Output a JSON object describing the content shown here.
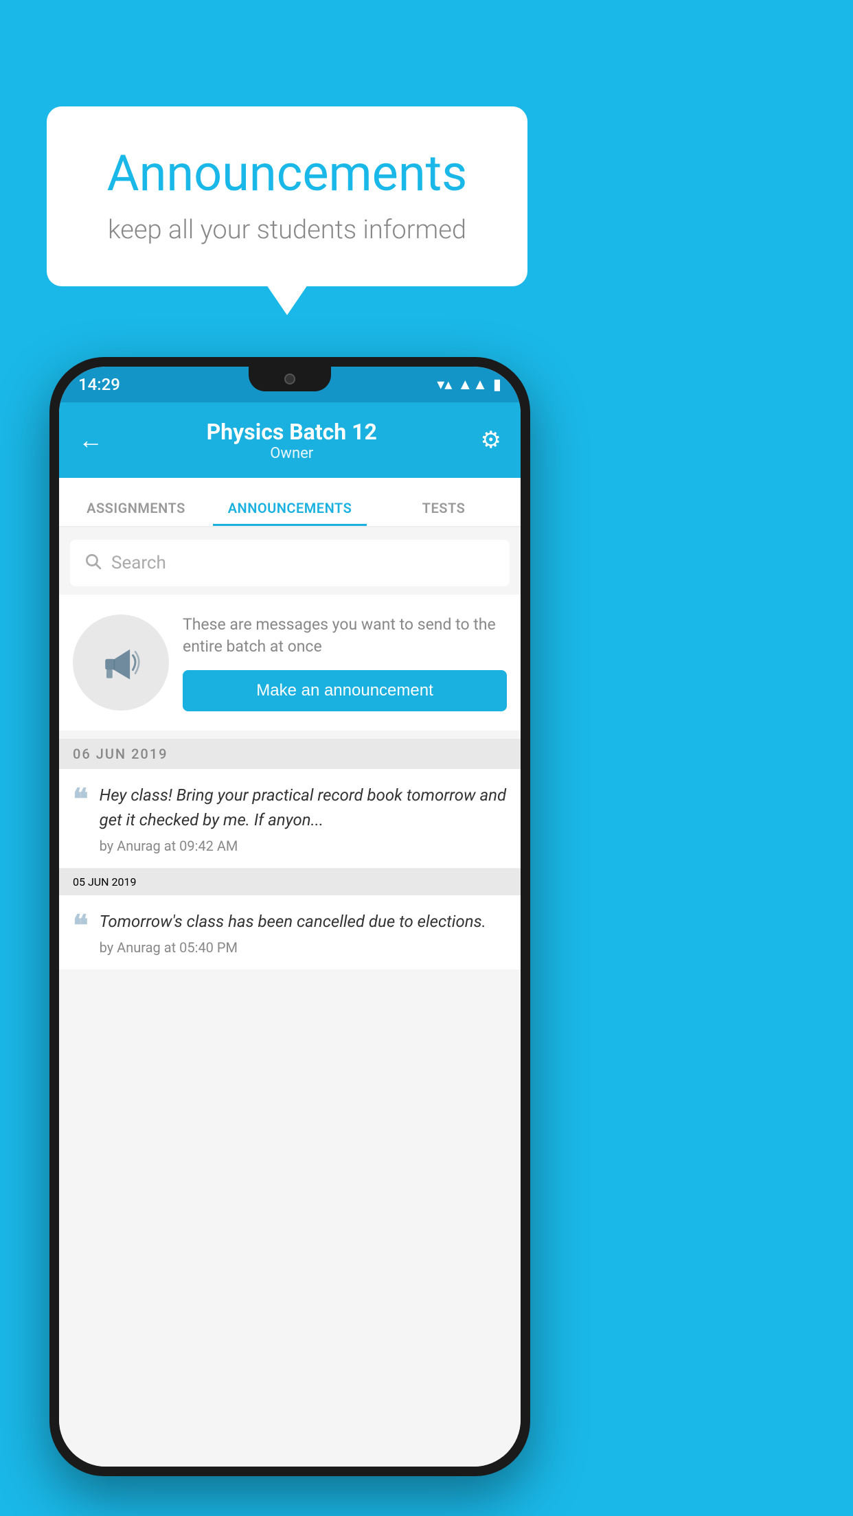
{
  "background": {
    "color": "#1ab8e8"
  },
  "speech_bubble": {
    "title": "Announcements",
    "subtitle": "keep all your students informed"
  },
  "phone": {
    "status_bar": {
      "time": "14:29",
      "icons": [
        "wifi",
        "signal",
        "battery"
      ]
    },
    "header": {
      "batch_name": "Physics Batch 12",
      "role": "Owner",
      "back_label": "←",
      "settings_label": "⚙"
    },
    "tabs": [
      {
        "label": "ASSIGNMENTS",
        "active": false
      },
      {
        "label": "ANNOUNCEMENTS",
        "active": true
      },
      {
        "label": "TESTS",
        "active": false
      },
      {
        "label": "...",
        "active": false
      }
    ],
    "search": {
      "placeholder": "Search"
    },
    "promo": {
      "description": "These are messages you want to send to the entire batch at once",
      "button_label": "Make an announcement"
    },
    "announcements": [
      {
        "date": "06  JUN  2019",
        "text": "Hey class! Bring your practical record book tomorrow and get it checked by me. If anyon...",
        "meta": "by Anurag at 09:42 AM"
      },
      {
        "date": "05  JUN  2019",
        "text": "Tomorrow's class has been cancelled due to elections.",
        "meta": "by Anurag at 05:40 PM"
      }
    ]
  }
}
